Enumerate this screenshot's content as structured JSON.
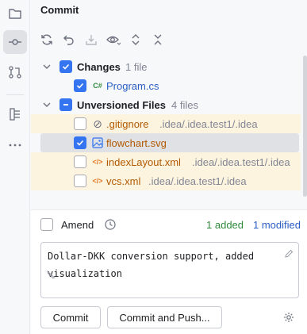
{
  "panel": {
    "title": "Commit"
  },
  "stripe": {
    "items": [
      {
        "name": "project-folder-icon",
        "active": false
      },
      {
        "name": "commit-icon",
        "active": true
      },
      {
        "name": "pull-requests-icon",
        "active": false
      },
      {
        "name": "structure-icon",
        "active": false
      },
      {
        "name": "more-icon",
        "active": false
      }
    ]
  },
  "toolbar": {
    "icons": [
      "refresh-icon",
      "rollback-icon",
      "shelve-icon",
      "show-diff-icon",
      "expand-all-icon",
      "collapse-all-icon"
    ]
  },
  "changes": {
    "groups": [
      {
        "label": "Changes",
        "count": "1 file",
        "checked": "all"
      },
      {
        "label": "Unversioned Files",
        "count": "4 files",
        "checked": "partial"
      }
    ],
    "files": [
      {
        "name": "Program.cs",
        "path": "",
        "checked": true,
        "icon": "csharp-file-icon",
        "icon_text": "C#"
      },
      {
        "name": ".gitignore",
        "path": ".idea/.idea.test1/.idea",
        "checked": false,
        "icon": "ignore-file-icon",
        "icon_text": "⊘"
      },
      {
        "name": "flowchart.svg",
        "path": "",
        "checked": true,
        "icon": "image-file-icon",
        "icon_text": ""
      },
      {
        "name": "indexLayout.xml",
        "path": ".idea/.idea.test1/.idea",
        "checked": false,
        "icon": "xml-file-icon",
        "icon_text": "</>"
      },
      {
        "name": "vcs.xml",
        "path": ".idea/.idea.test1/.idea",
        "checked": false,
        "icon": "xml-file-icon",
        "icon_text": "</>"
      }
    ]
  },
  "amend": {
    "label": "Amend",
    "checked": false
  },
  "stats": {
    "added": "1 added",
    "modified": "1 modified"
  },
  "commit_message": "Dollar-DKK conversion support, added\nvisualization",
  "buttons": {
    "commit": "Commit",
    "commit_and_push": "Commit and Push..."
  },
  "colors": {
    "accent": "#3574f0",
    "added": "#2f8a3b",
    "modified": "#2b5fc5",
    "unversioned": "#b35a00",
    "highlight": "#fdf4e0"
  }
}
